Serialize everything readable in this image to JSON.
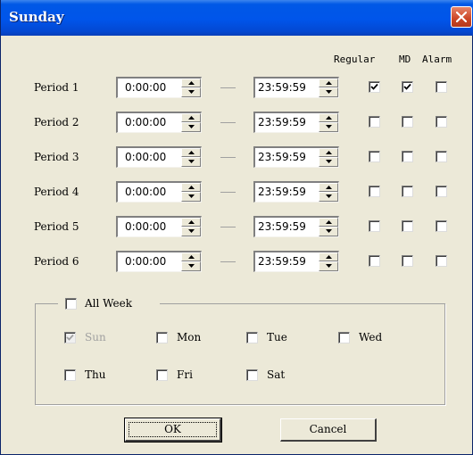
{
  "window": {
    "title": "Sunday",
    "close_icon": "close-icon"
  },
  "columns": {
    "regular": "Regular",
    "md": "MD",
    "alarm": "Alarm"
  },
  "periods": [
    {
      "label": "Period 1",
      "start": "0:00:00",
      "end": "23:59:59",
      "regular": true,
      "md": true,
      "alarm": false
    },
    {
      "label": "Period 2",
      "start": "0:00:00",
      "end": "23:59:59",
      "regular": false,
      "md": false,
      "alarm": false
    },
    {
      "label": "Period 3",
      "start": "0:00:00",
      "end": "23:59:59",
      "regular": false,
      "md": false,
      "alarm": false
    },
    {
      "label": "Period 4",
      "start": "0:00:00",
      "end": "23:59:59",
      "regular": false,
      "md": false,
      "alarm": false
    },
    {
      "label": "Period 5",
      "start": "0:00:00",
      "end": "23:59:59",
      "regular": false,
      "md": false,
      "alarm": false
    },
    {
      "label": "Period 6",
      "start": "0:00:00",
      "end": "23:59:59",
      "regular": false,
      "md": false,
      "alarm": false
    }
  ],
  "week": {
    "all_week_label": "All Week",
    "all_week_checked": false,
    "days": [
      {
        "label": "Sun",
        "checked": true,
        "disabled": true
      },
      {
        "label": "Mon",
        "checked": false,
        "disabled": false
      },
      {
        "label": "Tue",
        "checked": false,
        "disabled": false
      },
      {
        "label": "Wed",
        "checked": false,
        "disabled": false
      },
      {
        "label": "Thu",
        "checked": false,
        "disabled": false
      },
      {
        "label": "Fri",
        "checked": false,
        "disabled": false
      },
      {
        "label": "Sat",
        "checked": false,
        "disabled": false
      }
    ]
  },
  "buttons": {
    "ok": "OK",
    "cancel": "Cancel"
  },
  "colors": {
    "titlebar": "#0055ea",
    "face": "#ece9d8",
    "close": "#cc4626",
    "disabled_text": "#a0a0a0"
  }
}
